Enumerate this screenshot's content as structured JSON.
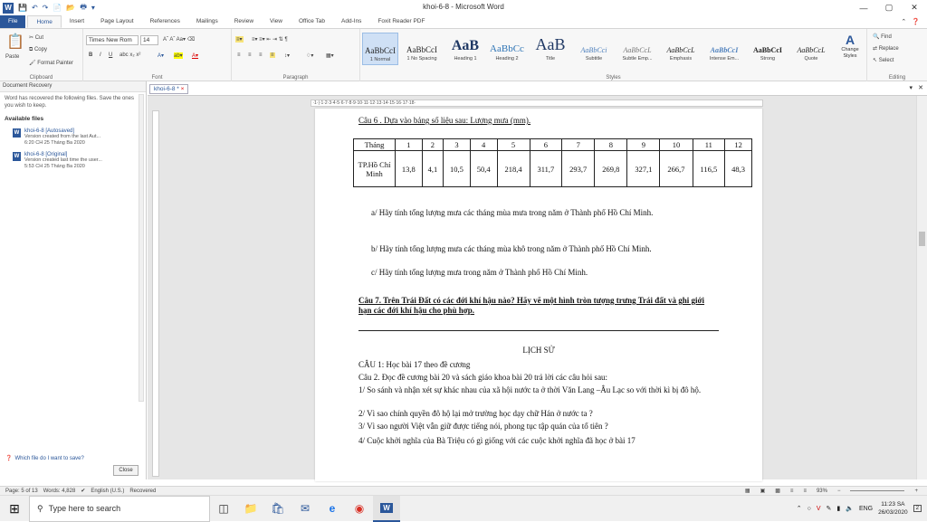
{
  "window": {
    "title": "khoi-6-8 - Microsoft Word",
    "min": "—",
    "max": "▢",
    "close": "✕"
  },
  "tabs": [
    "File",
    "Home",
    "Insert",
    "Page Layout",
    "References",
    "Mailings",
    "Review",
    "View",
    "Office Tab",
    "Add-Ins",
    "Foxit Reader PDF"
  ],
  "ribbon": {
    "clipboard": {
      "paste": "Paste",
      "cut": "Cut",
      "copy": "Copy",
      "format_painter": "Format Painter",
      "label": "Clipboard"
    },
    "font": {
      "name": "Times New Rom",
      "size": "14",
      "label": "Font"
    },
    "paragraph": {
      "label": "Paragraph"
    },
    "styles": {
      "label": "Styles",
      "items": [
        {
          "sample": "AaBbCcI",
          "name": "1 Normal"
        },
        {
          "sample": "AaBbCcI",
          "name": "1 No Spacing"
        },
        {
          "sample": "AaB",
          "name": "Heading 1"
        },
        {
          "sample": "AaBbCc",
          "name": "Heading 2"
        },
        {
          "sample": "AaB",
          "name": "Title"
        },
        {
          "sample": "AaBbCci",
          "name": "Subtitle"
        },
        {
          "sample": "AaBbCcL",
          "name": "Subtle Emp..."
        },
        {
          "sample": "AaBbCcL",
          "name": "Emphasis"
        },
        {
          "sample": "AaBbCcI",
          "name": "Intense Em..."
        },
        {
          "sample": "AaBbCcI",
          "name": "Strong"
        },
        {
          "sample": "AaBbCcL",
          "name": "Quote"
        }
      ],
      "change_styles": "Change Styles"
    },
    "editing": {
      "find": "Find",
      "replace": "Replace",
      "select": "Select",
      "label": "Editing"
    }
  },
  "recovery": {
    "header": "Document Recovery",
    "message": "Word has recovered the following files. Save the ones you wish to keep.",
    "available": "Available files",
    "files": [
      {
        "name": "khoi-6-8 [Autosaved]",
        "line1": "Version created from the last Aut...",
        "line2": "6:20 CH 25 Tháng Ba 2020"
      },
      {
        "name": "khoi-6-8 [Original]",
        "line1": "Version created last time the user...",
        "line2": "5:53 CH 25 Tháng Ba 2020"
      }
    ],
    "help": "Which file do I want to save?",
    "close": "Close"
  },
  "doctab": "khoi-6-8 *",
  "document": {
    "q6": "Câu 6 . Dựa vào bảng số liệu sau: Lượng mưa (mm).",
    "table": {
      "header": [
        "Tháng",
        "1",
        "2",
        "3",
        "4",
        "5",
        "6",
        "7",
        "8",
        "9",
        "10",
        "11",
        "12"
      ],
      "row_label": "TP.Hồ Chí Minh",
      "values": [
        "13,8",
        "4,1",
        "10,5",
        "50,4",
        "218,4",
        "311,7",
        "293,7",
        "269,8",
        "327,1",
        "266,7",
        "116,5",
        "48,3"
      ]
    },
    "qa": "a/ Hãy tính tổng lượng mưa các tháng mùa mưa trong năm ở Thành phố Hồ Chí Minh.",
    "qb": "b/ Hãy tính tổng lượng mưa các tháng mùa khô trong năm ở Thành phố Hồ Chí Minh.",
    "qc": "c/ Hãy tính tổng lượng mưa trong năm ở Thành phố Hồ Chí Minh.",
    "q7": "Câu 7. Trên Trái Đất có các đới khí hậu nào? Hãy vẽ một hình tròn tượng trưng Trái đất và ghi giới hạn các đới khí hậu cho phù hợp.",
    "history_title": "LỊCH SỬ",
    "h1": "CÂU 1: Học bài 17 theo đề cương",
    "h2": "Câu 2. Đọc đề cương bài 20 và sách giáo khoa bài 20 trả lời các câu hỏi sau:",
    "h3": "1/ So sánh và nhận xét sự khác nhau của xã hội nước ta ở thời Văn Lang –Âu Lạc so với thời kì bị đô hộ.",
    "h4": "2/ Vì sao chính quyền đô hộ lại mở trường học dạy chữ Hán ở nước ta ?",
    "h5": "3/ Vì sao người Việt vẫn giữ được tiếng nói, phong tục tập quán của tổ tiên ?",
    "h6": "4/ Cuộc khởi nghĩa của Bà Triệu có gì giống với các cuộc khởi nghĩa đã học ở bài 17"
  },
  "status": {
    "page": "Page: 5 of 13",
    "words": "Words: 4,828",
    "lang": "English (U.S.)",
    "mode": "Recovered",
    "zoom": "93%"
  },
  "taskbar": {
    "search": "Type here to search",
    "lang": "ENG",
    "time": "11:23 SA",
    "date": "26/03/2020",
    "notif": "2"
  }
}
